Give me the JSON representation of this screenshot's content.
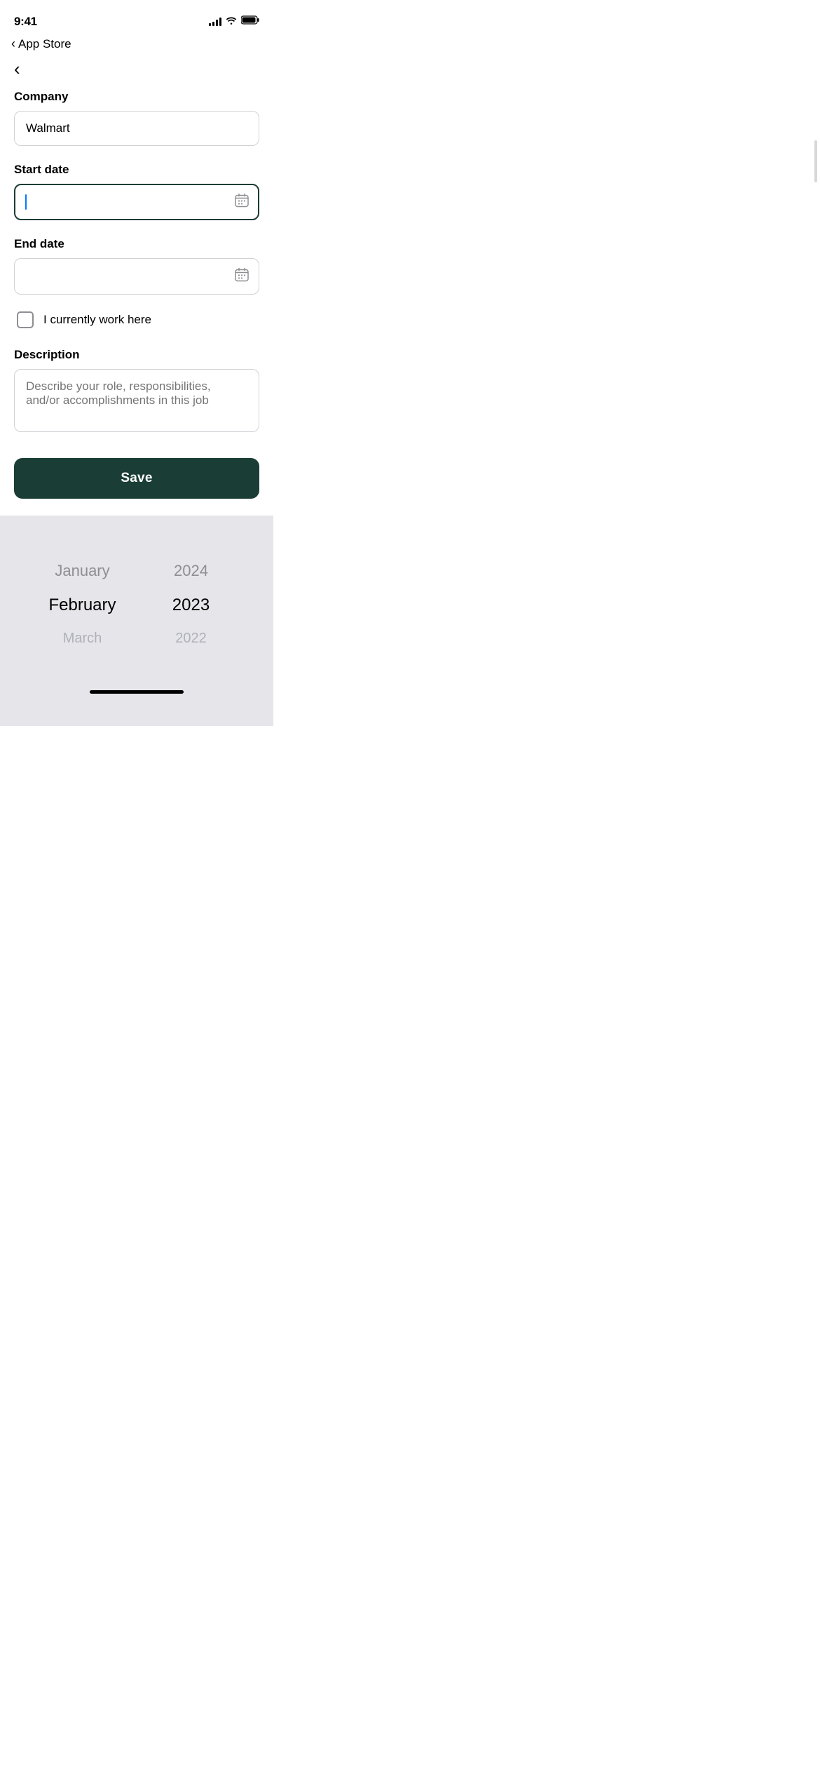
{
  "statusBar": {
    "time": "9:41",
    "backNav": "App Store"
  },
  "navigation": {
    "backLabel": "‹",
    "appStoreLabel": "App Store"
  },
  "form": {
    "companyLabel": "Company",
    "companyValue": "Walmart",
    "companyPlaceholder": "Company",
    "startDateLabel": "Start date",
    "startDateValue": "",
    "startDatePlaceholder": "",
    "endDateLabel": "End date",
    "endDateValue": "",
    "endDatePlaceholder": "",
    "checkboxLabel": "I currently work here",
    "descriptionLabel": "Description",
    "descriptionPlaceholder": "Describe your role, responsibilities, and/or accomplishments in this job",
    "saveButton": "Save"
  },
  "datePicker": {
    "months": [
      "January",
      "February",
      "March"
    ],
    "years": [
      "2024",
      "2023",
      "2022"
    ]
  },
  "colors": {
    "accent": "#1a3d35",
    "inputFocused": "#1a3d35",
    "placeholder": "#8e8e93",
    "border": "#d1d1d6",
    "overlayBg": "#e5e5ea"
  }
}
